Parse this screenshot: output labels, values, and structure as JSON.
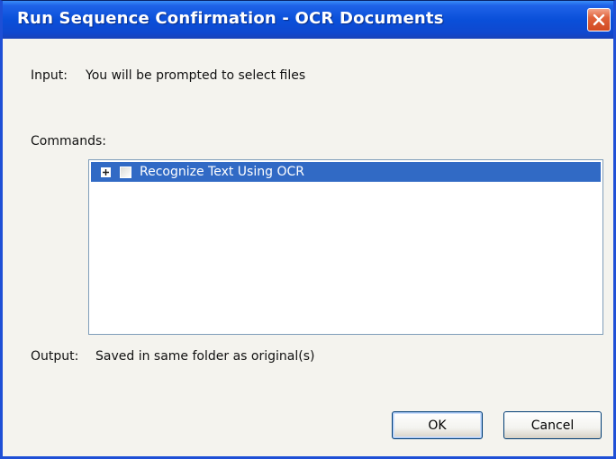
{
  "window": {
    "title": "Run Sequence Confirmation - OCR Documents"
  },
  "icons": {
    "close": "close-icon",
    "expand": "plus-expander-icon",
    "checkbox": "checkbox-icon"
  },
  "colors": {
    "titlebar": "#0A4FD9",
    "selection": "#316AC5",
    "close_button": "#E0623B",
    "dialog_background": "#F4F3EE"
  },
  "input": {
    "label": "Input:",
    "value": "You will be prompted to select files"
  },
  "commands": {
    "label": "Commands:",
    "items": [
      {
        "label": "Recognize Text Using OCR",
        "checked": false,
        "expanded": false,
        "selected": true
      }
    ]
  },
  "output": {
    "label": "Output:",
    "value": "Saved in same folder as original(s)"
  },
  "buttons": {
    "ok": "OK",
    "cancel": "Cancel"
  }
}
